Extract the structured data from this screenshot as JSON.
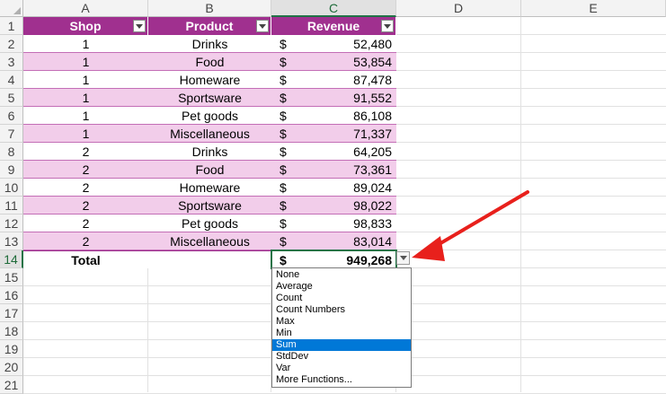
{
  "columns": [
    "A",
    "B",
    "C",
    "D",
    "E"
  ],
  "rows": [
    "1",
    "2",
    "3",
    "4",
    "5",
    "6",
    "7",
    "8",
    "9",
    "10",
    "11",
    "12",
    "13",
    "14",
    "15",
    "16",
    "17",
    "18",
    "19",
    "20",
    "21"
  ],
  "table": {
    "headers": {
      "shop": "Shop",
      "product": "Product",
      "revenue": "Revenue"
    },
    "rows": [
      {
        "shop": "1",
        "product": "Drinks",
        "currency": "$",
        "revenue": "52,480"
      },
      {
        "shop": "1",
        "product": "Food",
        "currency": "$",
        "revenue": "53,854"
      },
      {
        "shop": "1",
        "product": "Homeware",
        "currency": "$",
        "revenue": "87,478"
      },
      {
        "shop": "1",
        "product": "Sportsware",
        "currency": "$",
        "revenue": "91,552"
      },
      {
        "shop": "1",
        "product": "Pet goods",
        "currency": "$",
        "revenue": "86,108"
      },
      {
        "shop": "1",
        "product": "Miscellaneous",
        "currency": "$",
        "revenue": "71,337"
      },
      {
        "shop": "2",
        "product": "Drinks",
        "currency": "$",
        "revenue": "64,205"
      },
      {
        "shop": "2",
        "product": "Food",
        "currency": "$",
        "revenue": "73,361"
      },
      {
        "shop": "2",
        "product": "Homeware",
        "currency": "$",
        "revenue": "89,024"
      },
      {
        "shop": "2",
        "product": "Sportsware",
        "currency": "$",
        "revenue": "98,022"
      },
      {
        "shop": "2",
        "product": "Pet goods",
        "currency": "$",
        "revenue": "98,833"
      },
      {
        "shop": "2",
        "product": "Miscellaneous",
        "currency": "$",
        "revenue": "83,014"
      }
    ],
    "total": {
      "label": "Total",
      "currency": "$",
      "value": "949,268"
    }
  },
  "total_dropdown": {
    "options": [
      "None",
      "Average",
      "Count",
      "Count Numbers",
      "Max",
      "Min",
      "Sum",
      "StdDev",
      "Var",
      "More Functions..."
    ],
    "selected": "Sum"
  },
  "colors": {
    "header": "#a0308f",
    "band": "#f2cdea",
    "accent": "#217346",
    "arrow": "#e8201c",
    "selection": "#0078d7"
  }
}
